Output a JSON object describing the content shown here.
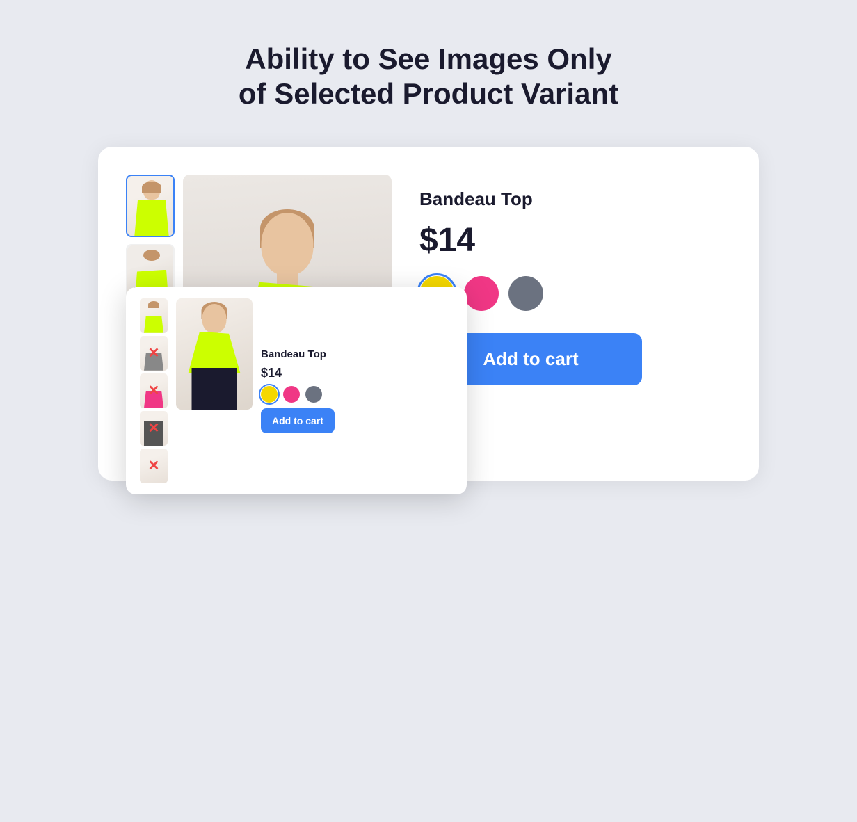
{
  "page": {
    "title_line1": "Ability to See Images Only",
    "title_line2": "of Selected Product Variant",
    "background_color": "#e8eaf0"
  },
  "main_product": {
    "name": "Bandeau Top",
    "price": "$14",
    "add_to_cart_label": "Add to cart",
    "colors": [
      {
        "id": "yellow",
        "hex": "#f5d800",
        "selected": true
      },
      {
        "id": "pink",
        "hex": "#f03785",
        "selected": false
      },
      {
        "id": "gray",
        "hex": "#6b7280",
        "selected": false
      }
    ]
  },
  "mini_card": {
    "name": "Bandeau Top",
    "price": "$14",
    "add_to_cart_label": "Add to cart",
    "colors": [
      {
        "id": "yellow",
        "hex": "#f5d800",
        "selected": true
      },
      {
        "id": "pink",
        "hex": "#f03785",
        "selected": false
      },
      {
        "id": "gray",
        "hex": "#6b7280",
        "selected": false
      }
    ],
    "crossed_thumbnails_count": 4
  },
  "icons": {
    "cursor": "▲",
    "cross": "✕"
  }
}
